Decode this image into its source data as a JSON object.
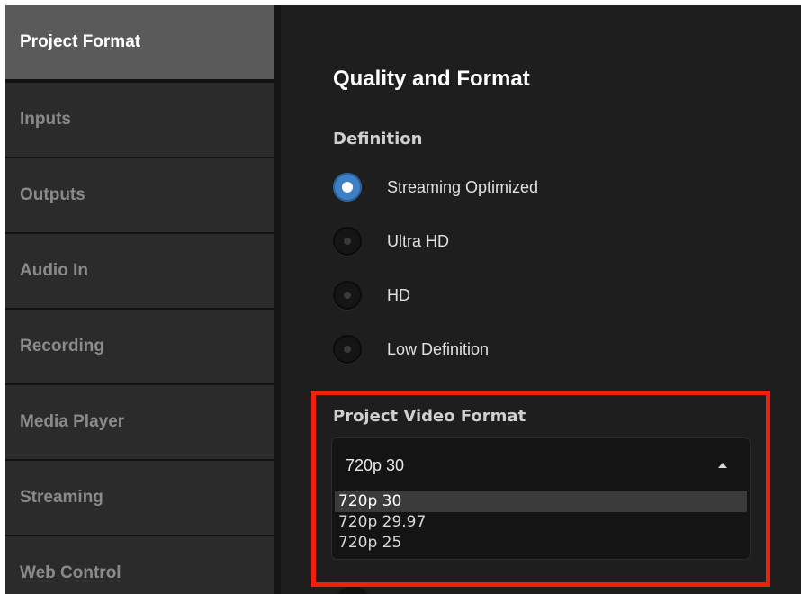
{
  "sidebar": {
    "items": [
      {
        "label": "Project Format"
      },
      {
        "label": "Inputs"
      },
      {
        "label": "Outputs"
      },
      {
        "label": "Audio In"
      },
      {
        "label": "Recording"
      },
      {
        "label": "Media Player"
      },
      {
        "label": "Streaming"
      },
      {
        "label": "Web Control"
      }
    ],
    "active_index": 0
  },
  "main": {
    "title": "Quality and Format",
    "definition": {
      "heading": "Definition",
      "options": [
        {
          "label": "Streaming Optimized",
          "checked": true
        },
        {
          "label": "Ultra HD",
          "checked": false
        },
        {
          "label": "HD",
          "checked": false
        },
        {
          "label": "Low Definition",
          "checked": false
        }
      ]
    },
    "video_format": {
      "heading": "Project Video Format",
      "value": "720p 30",
      "options": [
        "720p 30",
        "720p 29.97",
        "720p 25"
      ],
      "selected_index": 0
    }
  },
  "colors": {
    "accent": "#3f7fc4",
    "highlight": "#f0200f",
    "active_nav": "#5a5a5a"
  },
  "icons": {
    "caret": "caret-up-icon"
  }
}
